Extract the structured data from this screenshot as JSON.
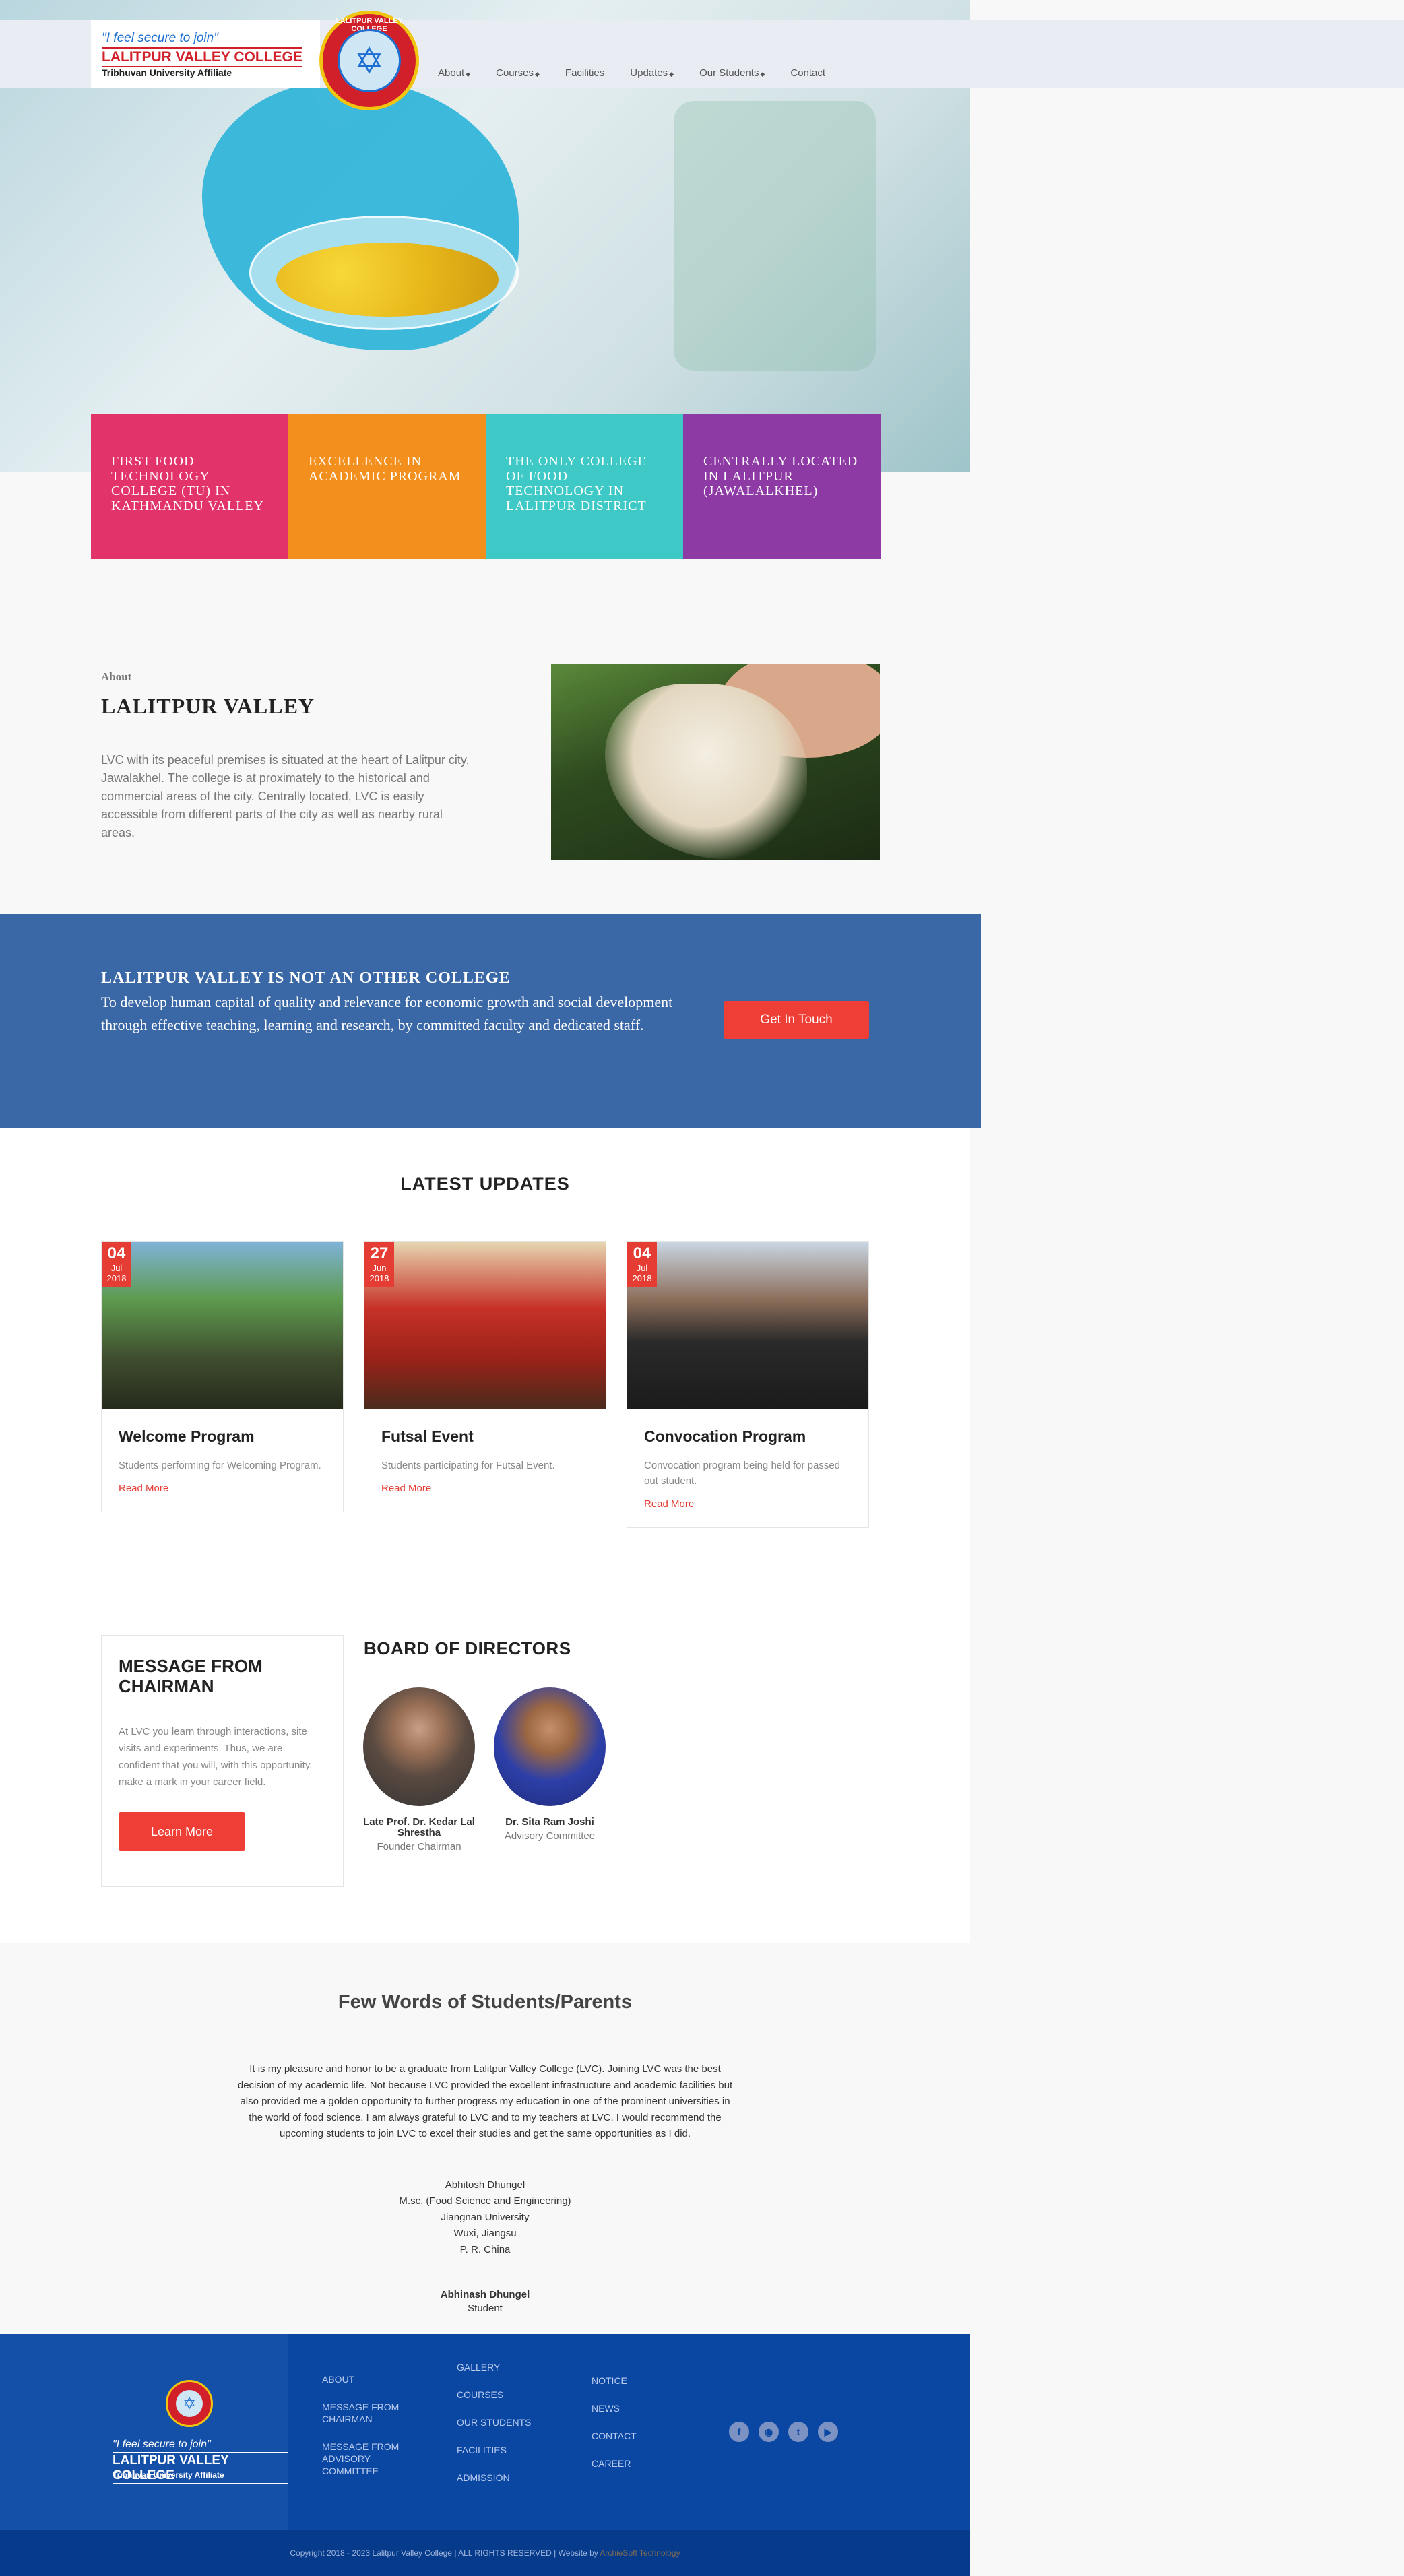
{
  "header": {
    "tagline": "\"I feel secure to join\"",
    "college_name": "LALITPUR VALLEY COLLEGE",
    "affiliate": "Tribhuvan University Affiliate",
    "seal_text": "LALITPUR VALLEY COLLEGE",
    "nav": [
      {
        "label": "About",
        "has_dropdown": true
      },
      {
        "label": "Courses",
        "has_dropdown": true
      },
      {
        "label": "Facilities",
        "has_dropdown": false
      },
      {
        "label": "Updates",
        "has_dropdown": true
      },
      {
        "label": "Our Students",
        "has_dropdown": true
      },
      {
        "label": "Contact",
        "has_dropdown": false
      }
    ]
  },
  "features": [
    {
      "text": "FIRST FOOD TECHNOLOGY COLLEGE (TU) IN KATHMANDU VALLEY",
      "color": "#e3336b"
    },
    {
      "text": "EXCELLENCE IN ACADEMIC PROGRAM",
      "color": "#f3901d"
    },
    {
      "text": "THE ONLY COLLEGE OF FOOD TECHNOLOGY IN LALITPUR DISTRICT",
      "color": "#3fc9c6"
    },
    {
      "text": "CENTRALLY LOCATED IN LALITPUR (JAWALALKHEL)",
      "color": "#8e3aa5"
    }
  ],
  "about": {
    "label": "About",
    "title": "LALITPUR VALLEY",
    "text": "LVC with its peaceful premises is situated at the heart of Lalitpur city, Jawalakhel. The college is at proximately to the historical and commercial areas of the city. Centrally located, LVC is easily accessible from different parts of the city as well as nearby rural areas."
  },
  "band": {
    "title": "LALITPUR VALLEY IS NOT AN OTHER COLLEGE",
    "text": "To develop human capital of quality and relevance for economic growth and social development through effective teaching, learning and research, by committed faculty and dedicated staff.",
    "button": "Get In Touch"
  },
  "updates": {
    "title": "LATEST UPDATES",
    "cards": [
      {
        "day": "04",
        "month": "Jul",
        "year": "2018",
        "title": "Welcome Program",
        "desc": "Students performing for Welcoming Program.",
        "link": "Read More"
      },
      {
        "day": "27",
        "month": "Jun",
        "year": "2018",
        "title": "Futsal Event",
        "desc": "Students participating for Futsal Event.",
        "link": "Read More"
      },
      {
        "day": "04",
        "month": "Jul",
        "year": "2018",
        "title": "Convocation Program",
        "desc": "Convocation program being held for passed out student.",
        "link": "Read More"
      }
    ]
  },
  "chairman": {
    "title": "MESSAGE FROM CHAIRMAN",
    "text": "At LVC you learn through interactions, site visits and experiments. Thus, we are confident that you will, with this opportunity, make a mark in your career field.",
    "button": "Learn More"
  },
  "board": {
    "title": "BOARD OF DIRECTORS",
    "directors": [
      {
        "name": "Late Prof. Dr. Kedar Lal Shrestha",
        "role": "Founder Chairman"
      },
      {
        "name": "Dr. Sita Ram Joshi",
        "role": "Advisory Committee"
      }
    ]
  },
  "testimonial": {
    "title": "Few Words of Students/Parents",
    "text": "It is my pleasure and honor to be a graduate from Lalitpur Valley College (LVC). Joining LVC was the best decision of my academic life. Not because LVC provided the excellent infrastructure and academic facilities but also provided me a golden opportunity to further progress my education in one of the prominent universities in the world of food science. I am always grateful to LVC and to my teachers at LVC. I would recommend the upcoming students to join LVC to excel their studies and get the same opportunities as I did.",
    "lines": [
      "Abhitosh Dhungel",
      "M.sc. (Food Science and Engineering)",
      "Jiangnan University",
      "Wuxi, Jiangsu",
      "P. R. China"
    ],
    "name": "Abhinash Dhungel",
    "role": "Student"
  },
  "footer": {
    "tagline": "\"I feel secure to join\"",
    "college_name": "LALITPUR VALLEY COLLEGE",
    "affiliate": "Tribhuvan University Affiliate",
    "col1": [
      "ABOUT",
      "MESSAGE FROM CHAIRMAN",
      "MESSAGE FROM ADVISORY COMMITTEE"
    ],
    "col2": [
      "GALLERY",
      "COURSES",
      "OUR STUDENTS",
      "FACILITIES",
      "ADMISSION"
    ],
    "col3": [
      "NOTICE",
      "NEWS",
      "CONTACT",
      "CAREER"
    ],
    "social": [
      "facebook-icon",
      "instagram-icon",
      "twitter-icon",
      "youtube-icon"
    ],
    "copyright": "Copyright 2018 - 2023 Lalitpur Valley College | ALL RIGHTS RESERVED | Website by",
    "developer": "ArchieSoft Technology"
  }
}
